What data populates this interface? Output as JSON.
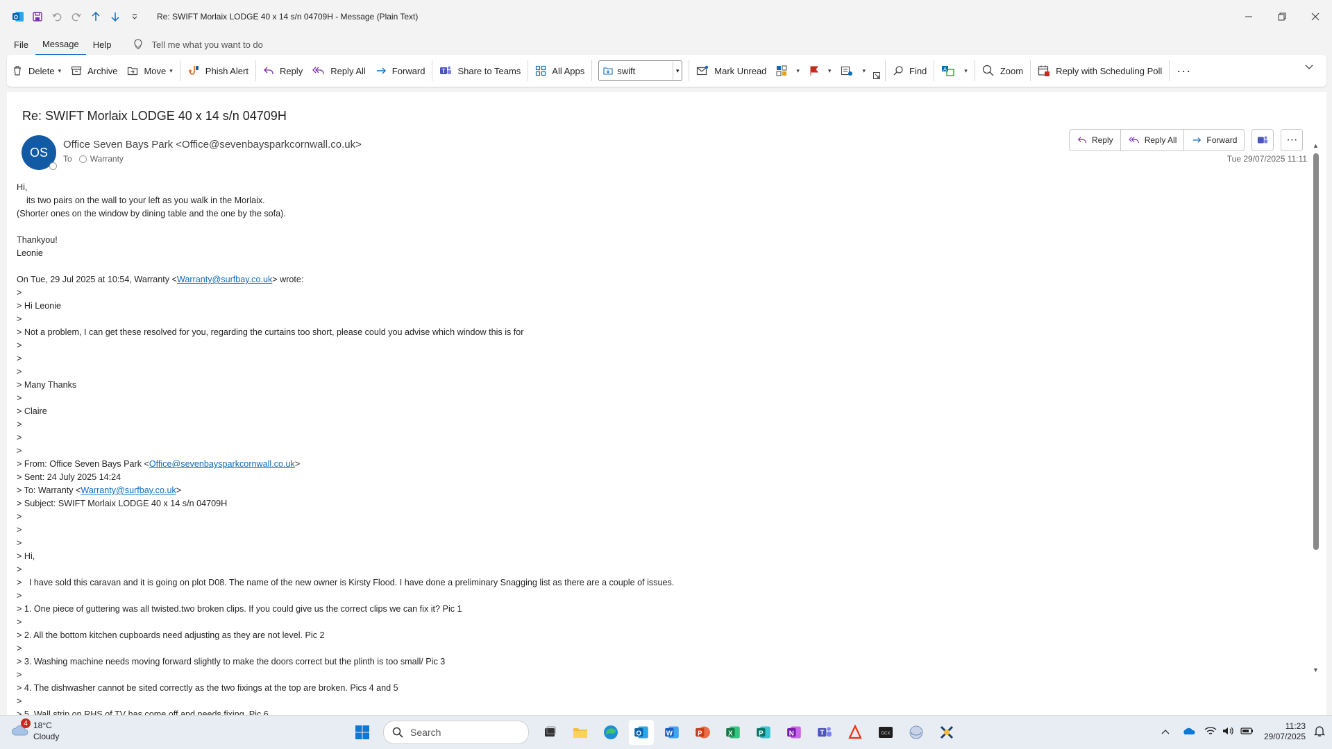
{
  "window": {
    "title": "Re: SWIFT Morlaix LODGE 40 x 14 s/n 04709H  -  Message (Plain Text)"
  },
  "menu": {
    "tabs": [
      "File",
      "Message",
      "Help"
    ],
    "active": "Message",
    "tell_me": "Tell me what you want to do"
  },
  "ribbon": {
    "delete": "Delete",
    "archive": "Archive",
    "move": "Move",
    "phish_alert": "Phish Alert",
    "reply": "Reply",
    "reply_all": "Reply All",
    "forward": "Forward",
    "share_to_teams": "Share to Teams",
    "all_apps": "All Apps",
    "quick_step_value": "swift",
    "mark_unread": "Mark Unread",
    "find": "Find",
    "zoom": "Zoom",
    "reply_scheduling_poll": "Reply with Scheduling Poll"
  },
  "message": {
    "subject": "Re: SWIFT Morlaix LODGE 40 x 14 s/n 04709H",
    "avatar_initials": "OS",
    "from": "Office Seven Bays Park <Office@sevenbaysparkcornwall.co.uk>",
    "to_label": "To",
    "to_name": "Warranty",
    "datetime": "Tue 29/07/2025 11:11",
    "actions": {
      "reply": "Reply",
      "reply_all": "Reply All",
      "forward": "Forward"
    },
    "body": [
      {
        "t": "Hi,"
      },
      {
        "t": "    its two pairs on the wall to your left as you walk in the Morlaix."
      },
      {
        "t": "(Shorter ones on the window by dining table and the one by the sofa)."
      },
      {
        "t": ""
      },
      {
        "t": "Thankyou!"
      },
      {
        "t": "Leonie"
      },
      {
        "t": ""
      },
      {
        "t": "On Tue, 29 Jul 2025 at 10:54, Warranty <",
        "link": "Warranty@surfbay.co.uk",
        "after": "> wrote:"
      },
      {
        "t": ">"
      },
      {
        "t": "> Hi Leonie"
      },
      {
        "t": ">"
      },
      {
        "t": "> Not a problem, I can get these resolved for you, regarding the curtains too short, please could you advise which window this is for"
      },
      {
        "t": ">"
      },
      {
        "t": ">"
      },
      {
        "t": ">"
      },
      {
        "t": "> Many Thanks"
      },
      {
        "t": ">"
      },
      {
        "t": "> Claire"
      },
      {
        "t": ">"
      },
      {
        "t": ">"
      },
      {
        "t": ">"
      },
      {
        "t": "> From: Office Seven Bays Park <",
        "link": "Office@sevenbaysparkcornwall.co.uk",
        "after": ">"
      },
      {
        "t": "> Sent: 24 July 2025 14:24"
      },
      {
        "t": "> To: Warranty <",
        "link": "Warranty@surfbay.co.uk",
        "after": ">"
      },
      {
        "t": "> Subject: SWIFT Morlaix LODGE 40 x 14 s/n 04709H"
      },
      {
        "t": ">"
      },
      {
        "t": ">"
      },
      {
        "t": ">"
      },
      {
        "t": "> Hi,"
      },
      {
        "t": ">"
      },
      {
        "t": ">   I have sold this caravan and it is going on plot D08. The name of the new owner is Kirsty Flood. I have done a preliminary Snagging list as there are a couple of issues."
      },
      {
        "t": ">"
      },
      {
        "t": "> 1. One piece of guttering was all twisted.two broken clips. If you could give us the correct clips we can fix it? Pic 1"
      },
      {
        "t": ">"
      },
      {
        "t": "> 2. All the bottom kitchen cupboards need adjusting as they are not level. Pic 2"
      },
      {
        "t": ">"
      },
      {
        "t": "> 3. Washing machine needs moving forward slightly to make the doors correct but the plinth is too small/ Pic 3"
      },
      {
        "t": ">"
      },
      {
        "t": "> 4. The dishwasher cannot be sited correctly as the two fixings at the top are broken. Pics 4 and 5"
      },
      {
        "t": ">"
      },
      {
        "t": "> 5. Wall strip on RHS of TV has come off and needs fixing. Pic 6"
      }
    ]
  },
  "taskbar": {
    "weather_temp": "18°C",
    "weather_desc": "Cloudy",
    "weather_badge": "4",
    "search_placeholder": "Search",
    "time": "11:23",
    "date": "29/07/2025"
  }
}
